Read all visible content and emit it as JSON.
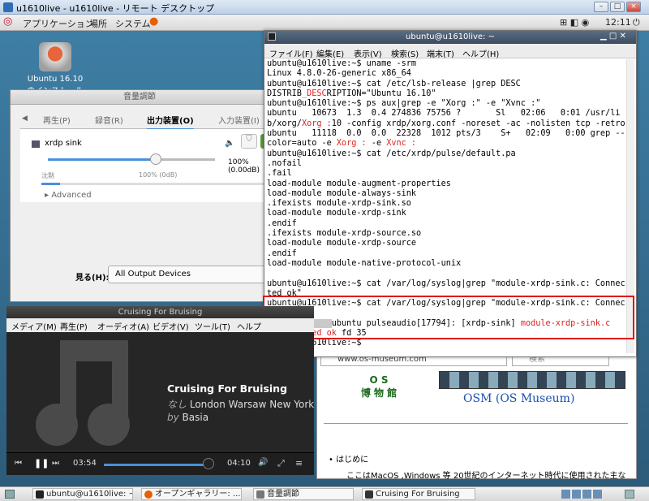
{
  "outer_window": {
    "title": "u1610live - u1610live - リモート デスクトップ"
  },
  "top_panel": {
    "applications": "アプリケーション",
    "places": "場所",
    "system": "システム",
    "clock": "12:11"
  },
  "desktop_icon": {
    "label": "Ubuntu 16.10 のインストール"
  },
  "sound_window": {
    "title": "音量調節",
    "tabs": [
      "再生(P)",
      "録音(R)",
      "出力装置(O)",
      "入力装置(I)"
    ],
    "active_tab": "出力装置(O)",
    "device_name": "xrdp sink",
    "volume_text": "100% (0.00dB)",
    "silence_label": "沈黙",
    "slider_mark": "100% (0dB)",
    "advanced": "Advanced",
    "view_label": "見る(H):",
    "view_value": "All Output Devices",
    "volume_level_percent": 100
  },
  "terminal": {
    "title": "ubuntu@u1610live: ~",
    "menu": [
      "ファイル(F)",
      "編集(E)",
      "表示(V)",
      "検索(S)",
      "端末(T)",
      "ヘルプ(H)"
    ],
    "lines": [
      "ubuntu@u1610live:~$ uname -srm",
      "Linux 4.8.0-26-generic x86_64",
      "ubuntu@u1610live:~$ cat /etc/lsb-release |grep DESC",
      "DISTRIB_DESCRIPTION=\"Ubuntu 16.10\"",
      "ubuntu@u1610live:~$ ps aux|grep -e \"Xorg :\" -e \"Xvnc :\"",
      "ubuntu   10673  1.3  0.4 274836 75756 ?       Sl   02:06   0:01 /usr/li",
      "b/xorg/Xorg :10 -config xrdp/xorg.conf -noreset -ac -nolisten tcp -retro",
      "ubuntu   11118  0.0  0.0  22328  1012 pts/3    S+   02:09   0:00 grep --",
      "color=auto -e Xorg : -e Xvnc :",
      "ubuntu@u1610live:~$ cat /etc/xrdp/pulse/default.pa",
      ".nofail",
      ".fail",
      "load-module module-augment-properties",
      "load-module module-always-sink",
      ".ifexists module-xrdp-sink.so",
      "load-module module-xrdp-sink",
      ".endif",
      ".ifexists module-xrdp-source.so",
      "load-module module-xrdp-source",
      ".endif",
      "load-module module-native-protocol-unix",
      "",
      "ubuntu@u1610live:~$ cat /var/log/syslog|grep \"module-xrdp-sink.c: Connec",
      "ted ok\"",
      "ubuntu@u1610live:~$ cat /var/log/syslog|grep \"module-xrdp-sink.c: Connec",
      "ted ok\"",
      "             ubuntu pulseaudio[17794]: [xrdp-sink] module-xrdp-sink.c",
      ": Connected ok fd 35",
      "ubuntu@u1610live:~$ "
    ]
  },
  "browser": {
    "url": "www.os-museum.com",
    "search_placeholder": "検索",
    "logo_top": "O S",
    "logo_bottom": "博 物 館",
    "site_title": "OSM (OS Museum)",
    "bullet": "はじめに",
    "intro": "ここはMacOS ,Windows 等 20世紀のインターネット時代に使用された主な"
  },
  "video": {
    "title": "Cruising For Bruising",
    "menu": [
      "メディア(M)",
      "再生(P)",
      "オーディオ(A)",
      "ビデオ(V)",
      "ツール(T)",
      "ヘルプ"
    ],
    "song": "Cruising For Bruising",
    "meta_prefix": "なし",
    "album": "London Warsaw New York",
    "by_prefix": "by",
    "artist": "Basia",
    "elapsed": "03:54",
    "total": "04:10",
    "progress_fraction": 0.93
  },
  "taskbar": {
    "items": [
      "ubuntu@u1610live: ~",
      "オープンギャラリー: ...",
      "音量調節",
      "Cruising For Bruising"
    ]
  }
}
